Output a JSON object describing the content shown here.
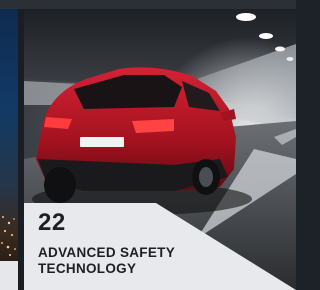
{
  "cards": [
    {
      "number": "22",
      "title": "ADVANCED SAFETY TECHNOLOGY",
      "image_icon": "red-suv-in-tunnel-photo"
    }
  ]
}
